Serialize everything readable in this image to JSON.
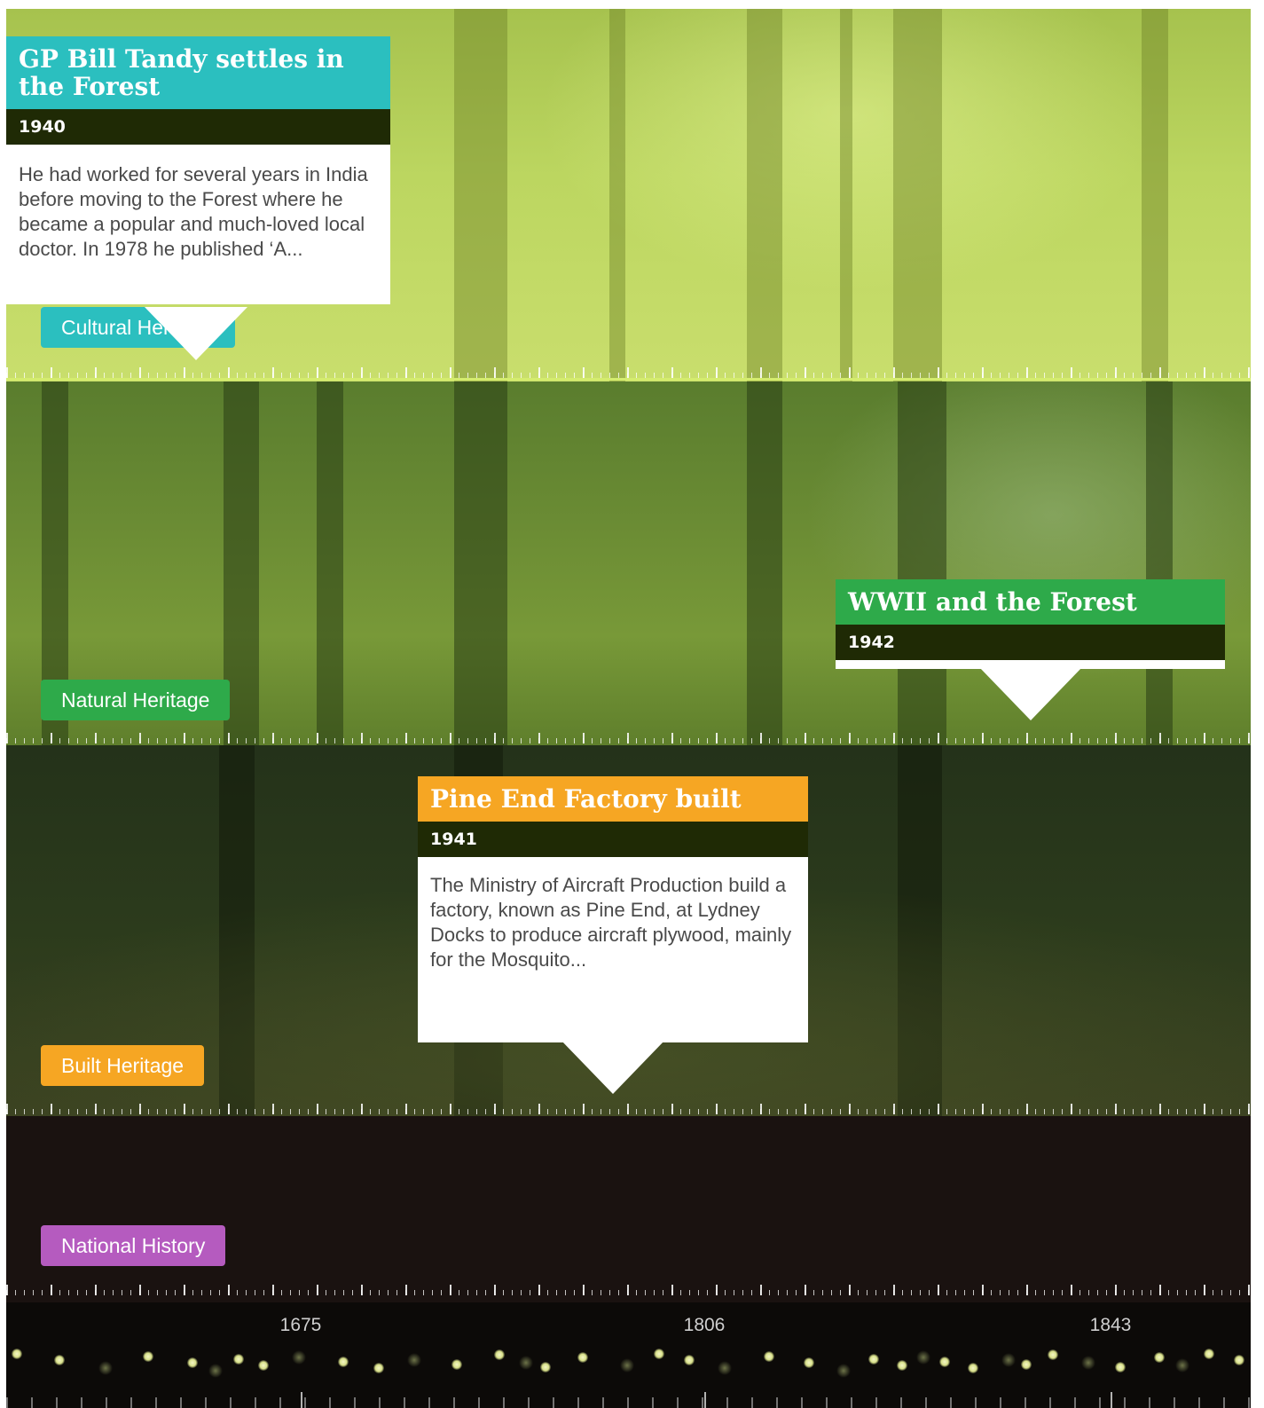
{
  "tags": {
    "cultural": "Cultural Heritage",
    "natural": "Natural Heritage",
    "built": "Built Heritage",
    "national": "National History"
  },
  "events": [
    {
      "title": "GP Bill Tandy settles in the Forest",
      "year": "1940",
      "description": "He had worked for several years in India before moving to the Forest where he became a popular and much-loved local doctor. In 1978 he published ‘A...",
      "category": "Cultural Heritage"
    },
    {
      "title": "WWII and the Forest",
      "year": "1942",
      "category": "Natural Heritage"
    },
    {
      "title": "Pine End Factory built",
      "year": "1941",
      "description": "The Ministry of Aircraft Production build a factory, known as Pine End, at Lydney Docks to produce aircraft plywood, mainly for the Mosquito...",
      "category": "Built Heritage"
    }
  ],
  "axis": {
    "labels": [
      "1675",
      "1806",
      "1843"
    ]
  },
  "colors": {
    "cultural": "#2bbfbf",
    "natural": "#2eaa4a",
    "built": "#f6a623",
    "national": "#b55bbf",
    "year_bar": "#1f2a05"
  }
}
